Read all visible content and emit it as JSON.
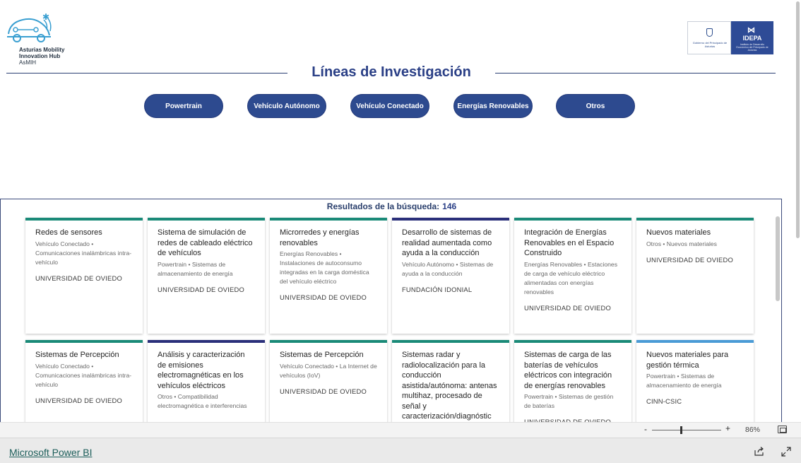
{
  "logo": {
    "line1": "Asturias Mobility",
    "line2": "Innovation Hub",
    "line3": "AsMIH",
    "icon": "car-network-icon"
  },
  "partners": {
    "a_text": "Gobierno del Principado de Asturias",
    "b_name": "IDEPA",
    "b_small": "Instituto de Desarrollo Económico del Principado de Asturias"
  },
  "title": "Líneas de Investigación",
  "categories": [
    "Powertrain",
    "Vehículo Autónomo",
    "Vehículo Conectado",
    "Energías Renovables",
    "Otros"
  ],
  "results": {
    "label": "Resultados de la búsqueda:",
    "count": "146",
    "cards": [
      {
        "title": "Redes de sensores",
        "tags": "Vehículo Conectado • Comunicaciones inalámbricas intra-vehículo",
        "org": "UNIVERSIDAD DE OVIEDO",
        "accent": "#1a8a78"
      },
      {
        "title": "Sistema de simulación de redes de cableado eléctrico de vehículos",
        "tags": "Powertrain • Sistemas de almacenamiento de energía",
        "org": "UNIVERSIDAD DE OVIEDO",
        "accent": "#1a8a78"
      },
      {
        "title": "Microrredes y energías renovables",
        "tags": "Energías Renovables • Instalaciones de autoconsumo integradas en la carga doméstica del vehículo eléctrico",
        "org": "UNIVERSIDAD DE OVIEDO",
        "accent": "#1a8a78"
      },
      {
        "title": "Desarrollo de sistemas de realidad aumentada como ayuda a la conducción",
        "tags": "Vehículo Autónomo • Sistemas de ayuda a la conducción",
        "org": "FUNDACIÓN IDONIAL",
        "accent": "#2a2f7a"
      },
      {
        "title": "Integración de Energías Renovables en el Espacio Construido",
        "tags": "Energías Renovables • Estaciones de carga de vehículo eléctrico alimentadas con energías renovables",
        "org": "UNIVERSIDAD DE OVIEDO",
        "accent": "#1a8a78"
      },
      {
        "title": "Nuevos materiales",
        "tags": "Otros • Nuevos materiales",
        "org": "UNIVERSIDAD DE OVIEDO",
        "accent": "#1a8a78"
      },
      {
        "title": "Sistemas de Percepción",
        "tags": "Vehículo Conectado • Comunicaciones inalámbricas intra-vehículo",
        "org": "UNIVERSIDAD DE OVIEDO",
        "accent": "#1a8a78"
      },
      {
        "title": "Análisis y caracterización de emisiones electromagnéticas en los vehículos eléctricos",
        "tags": "Otros • Compatibilidad electromagnética e interferencias",
        "org": "",
        "accent": "#2a2f7a"
      },
      {
        "title": "Sistemas de Percepción",
        "tags": "Vehículo Conectado • La Internet de vehículos (IoV)",
        "org": "UNIVERSIDAD DE OVIEDO",
        "accent": "#1a8a78"
      },
      {
        "title": "Sistemas radar y radiolocalización para la conducción asistida/autónoma: antenas multihaz, procesado de señal y caracterización/diagnóstic",
        "tags": "",
        "org": "",
        "accent": "#1a8a78"
      },
      {
        "title": "Sistemas de carga de las baterías de vehículos eléctricos con integración de energías renovables",
        "tags": "Powertrain • Sistemas de gestión de baterías",
        "org": "UNIVERSIDAD DE OVIEDO",
        "accent": "#1a8a78"
      },
      {
        "title": "Nuevos materiales para gestión térmica",
        "tags": "Powertrain • Sistemas de almacenamiento de energía",
        "org": "CINN-CSIC",
        "accent": "#4a9bd6"
      }
    ]
  },
  "zoom": {
    "minus": "-",
    "plus": "+",
    "value": "86%",
    "level": 0.86
  },
  "footer": {
    "link": "Microsoft Power BI"
  }
}
